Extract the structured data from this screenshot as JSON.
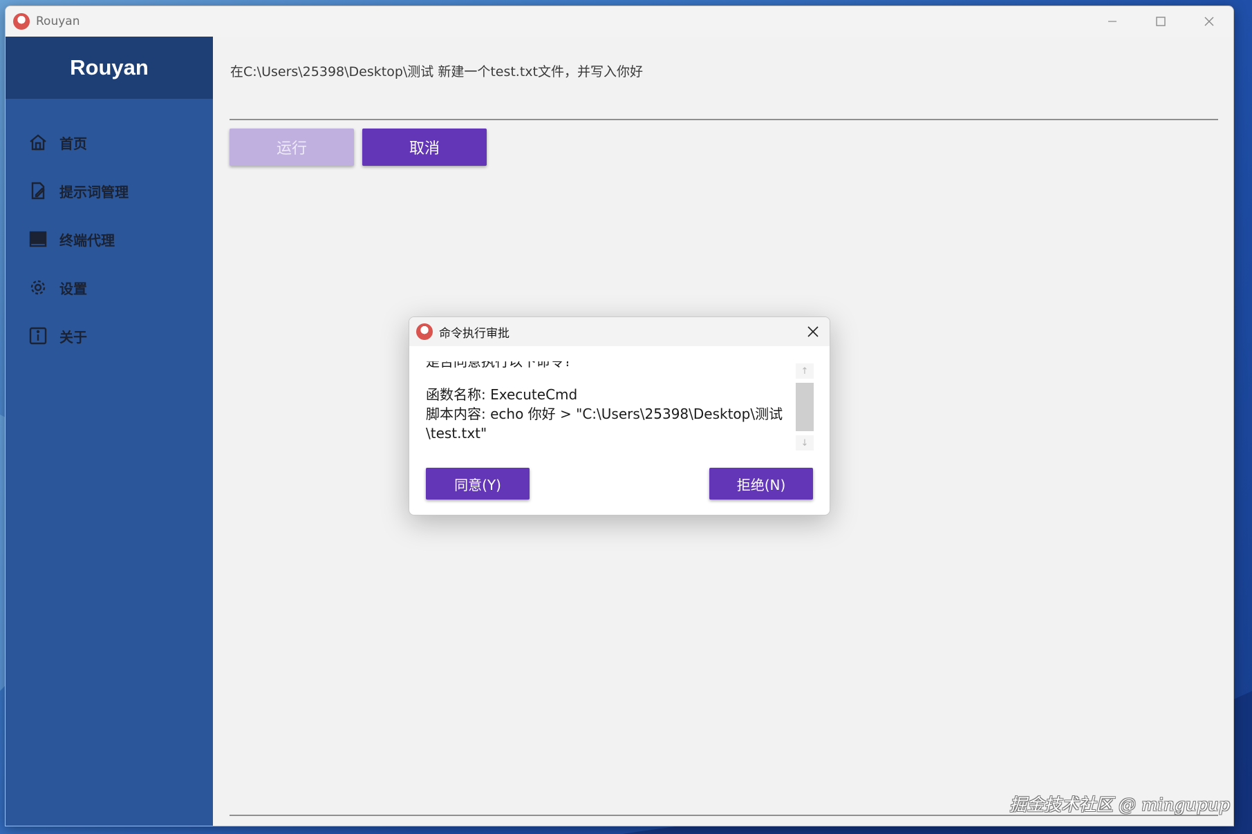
{
  "window": {
    "title": "Rouyan"
  },
  "sidebar": {
    "brand": "Rouyan",
    "items": [
      {
        "label": "首页",
        "icon": "home-icon"
      },
      {
        "label": "提示词管理",
        "icon": "edit-document-icon"
      },
      {
        "label": "终端代理",
        "icon": "terminal-icon"
      },
      {
        "label": "设置",
        "icon": "gear-icon"
      },
      {
        "label": "关于",
        "icon": "info-icon"
      }
    ]
  },
  "main": {
    "prompt_text": "在C:\\Users\\25398\\Desktop\\测试 新建一个test.txt文件，并写入你好",
    "run_label": "运行",
    "cancel_label": "取消"
  },
  "dialog": {
    "title": "命令执行审批",
    "question": "是否同意执行以下命令?",
    "function_line": "函数名称: ExecuteCmd",
    "script_line_1": "脚本内容: echo 你好 > \"C:\\Users\\25398\\Desktop\\测试",
    "script_line_2": "\\test.txt\"",
    "yes_label": "同意(Y)",
    "no_label": "拒绝(N)"
  },
  "watermark": "掘金技术社区 @ mingupup",
  "colors": {
    "sidebar": "#2b579a",
    "sidebar_header": "#1e3f75",
    "primary_button": "#6236b6",
    "disabled_button": "#bfb0e0"
  }
}
